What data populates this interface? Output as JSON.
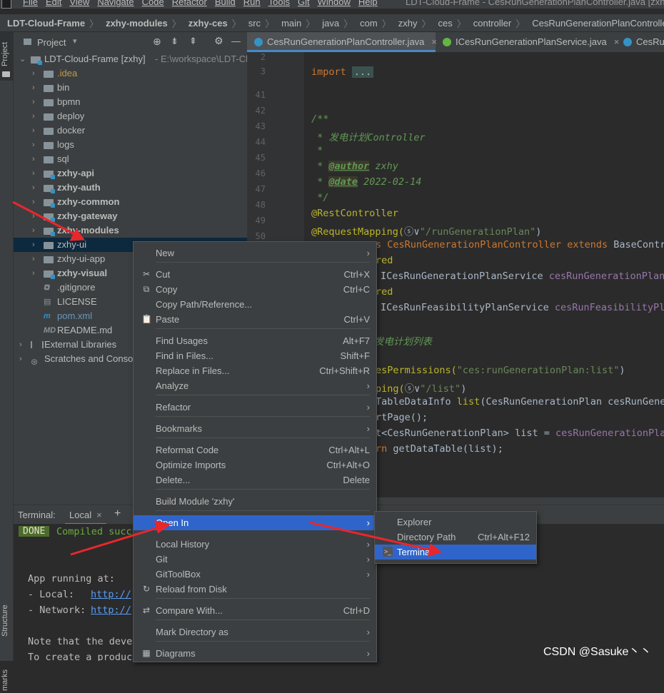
{
  "window": {
    "menu": [
      "File",
      "Edit",
      "View",
      "Navigate",
      "Code",
      "Refactor",
      "Build",
      "Run",
      "Tools",
      "Git",
      "Window",
      "Help"
    ],
    "title": "LDT-Cloud-Frame - CesRunGenerationPlanController.java [zxhy]"
  },
  "breadcrumb": [
    "LDT-Cloud-Frame",
    "zxhy-modules",
    "zxhy-ces",
    "src",
    "main",
    "java",
    "com",
    "zxhy",
    "ces",
    "controller",
    "CesRunGenerationPlanController",
    "cesRunGenera"
  ],
  "left_stripe": {
    "project": "Project",
    "structure": "Structure",
    "bookmarks": "marks"
  },
  "project_panel": {
    "title": "Project",
    "root": {
      "name": "LDT-Cloud-Frame [zxhy]",
      "path": "- E:\\workspace\\LDT-Cl"
    },
    "items": [
      {
        "name": ".idea",
        "kind": "folder",
        "color": "#c29a47"
      },
      {
        "name": "bin",
        "kind": "folder"
      },
      {
        "name": "bpmn",
        "kind": "folder"
      },
      {
        "name": "deploy",
        "kind": "folder"
      },
      {
        "name": "docker",
        "kind": "folder"
      },
      {
        "name": "logs",
        "kind": "folder"
      },
      {
        "name": "sql",
        "kind": "folder"
      },
      {
        "name": "zxhy-api",
        "kind": "module"
      },
      {
        "name": "zxhy-auth",
        "kind": "module"
      },
      {
        "name": "zxhy-common",
        "kind": "module"
      },
      {
        "name": "zxhy-gateway",
        "kind": "module"
      },
      {
        "name": "zxhy-modules",
        "kind": "module"
      },
      {
        "name": "zxhy-ui",
        "kind": "folder"
      },
      {
        "name": "zxhy-ui-app",
        "kind": "folder"
      },
      {
        "name": "zxhy-visual",
        "kind": "module"
      },
      {
        "name": ".gitignore",
        "kind": "file"
      },
      {
        "name": "LICENSE",
        "kind": "file"
      },
      {
        "name": "pom.xml",
        "kind": "file"
      },
      {
        "name": "README.md",
        "kind": "file"
      }
    ],
    "external": "External Libraries",
    "scratches": "Scratches and Conso"
  },
  "editor_tabs": [
    {
      "name": "CesRunGenerationPlanController.java",
      "active": true
    },
    {
      "name": "ICesRunGenerationPlanService.java",
      "active": false
    },
    {
      "name": "CesRun",
      "active": false
    }
  ],
  "editor": {
    "line_numbers": [
      "2",
      "3",
      "41",
      "42",
      "43",
      "44",
      "45",
      "46",
      "47",
      "48",
      "49",
      "50"
    ],
    "lines": {
      "l3_kw": "import",
      "l3_fold": "...",
      "l43": "/**",
      "l44": " * 发电计划Controller",
      "l45": " *",
      "l46_tag": "@author",
      "l46_val": " zxhy",
      "l47_tag": "@date",
      "l47_val": " 2022-02-14",
      "l48": " */",
      "l49": "@RestController",
      "l50_a": "@RequestMapping(",
      "l50_b": "\"/runGenerationPlan\"",
      "l50_c": ")",
      "l51_a": "s CesRunGenerationPlanController ",
      "l51_b": "extends",
      "l51_c": " BaseContro",
      "l52": "red",
      "l53_a": "ICesRunGenerationPlanService ",
      "l53_b": "cesRunGenerationPlanS",
      "l54": "red",
      "l55_a": "ICesRunFeasibilityPlanService ",
      "l55_b": "cesRunFeasibilityPla",
      "l56": "发电计划列表",
      "l57_a": "esPermissions(",
      "l57_b": "\"ces:runGenerationPlan:list\"",
      "l57_c": ")",
      "l58_a": "ping(",
      "l58_b": "\"/list\"",
      "l58_c": ")",
      "l59_a": "TableDataInfo ",
      "l59_b": "list",
      "l59_c": "(CesRunGenerationPlan cesRunGener",
      "l60": "rtPage();",
      "l61_a": "t<CesRunGenerationPlan> list = ",
      "l61_b": "cesRunGenerationPlan",
      "l62_a": "rn ",
      "l62_b": "getDataTable(list);"
    }
  },
  "terminal": {
    "title": "Terminal:",
    "tab": "Local",
    "done_badge": "DONE",
    "compiled": "Compiled succ",
    "app_running": "App running at:",
    "local_label": "- Local:   ",
    "local_url": "http://",
    "network_label": "- Network: ",
    "network_url": "http://",
    "note1": "Note that the deve",
    "note2": "To create a product"
  },
  "context_menu": {
    "items": [
      {
        "label": "New",
        "submenu": true
      },
      {
        "label": "Cut",
        "shortcut": "Ctrl+X",
        "icon": "cut-icon"
      },
      {
        "label": "Copy",
        "shortcut": "Ctrl+C",
        "icon": "copy-icon"
      },
      {
        "label": "Copy Path/Reference..."
      },
      {
        "label": "Paste",
        "shortcut": "Ctrl+V",
        "icon": "paste-icon"
      },
      {
        "label": "Find Usages",
        "shortcut": "Alt+F7"
      },
      {
        "label": "Find in Files...",
        "shortcut": "Shift+F"
      },
      {
        "label": "Replace in Files...",
        "shortcut": "Ctrl+Shift+R"
      },
      {
        "label": "Analyze",
        "submenu": true
      },
      {
        "label": "Refactor",
        "submenu": true
      },
      {
        "label": "Bookmarks",
        "submenu": true
      },
      {
        "label": "Reformat Code",
        "shortcut": "Ctrl+Alt+L"
      },
      {
        "label": "Optimize Imports",
        "shortcut": "Ctrl+Alt+O"
      },
      {
        "label": "Delete...",
        "shortcut": "Delete"
      },
      {
        "label": "Build Module 'zxhy'"
      },
      {
        "label": "Open In",
        "submenu": true,
        "highlighted": true
      },
      {
        "label": "Local History",
        "submenu": true
      },
      {
        "label": "Git",
        "submenu": true
      },
      {
        "label": "GitToolBox",
        "submenu": true
      },
      {
        "label": "Reload from Disk",
        "icon": "reload-icon"
      },
      {
        "label": "Compare With...",
        "shortcut": "Ctrl+D",
        "icon": "compare-icon"
      },
      {
        "label": "Mark Directory as",
        "submenu": true
      },
      {
        "label": "Diagrams",
        "submenu": true,
        "icon": "diagram-icon"
      }
    ]
  },
  "open_in_submenu": {
    "items": [
      {
        "label": "Explorer"
      },
      {
        "label": "Directory Path",
        "shortcut": "Ctrl+Alt+F12"
      },
      {
        "label": "Terminal",
        "highlighted": true,
        "icon": "terminal-icon"
      }
    ]
  },
  "watermark": "CSDN @Sasuke丶丶",
  "colors": {
    "accent": "#2f65ca",
    "annotation_arrow": "#e8272b",
    "background": "#2b2b2b",
    "panel": "#3c3f41"
  }
}
